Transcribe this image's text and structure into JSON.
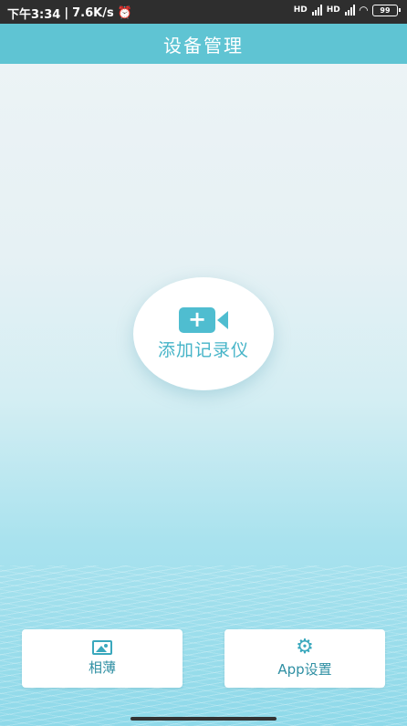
{
  "status_bar": {
    "time": "下午3:34",
    "speed": "7.6K/s",
    "battery": "99",
    "hd1": "HD",
    "hd2": "HD"
  },
  "header": {
    "title": "设备管理"
  },
  "main": {
    "add_label": "添加记录仪",
    "add_icon_symbol": "+"
  },
  "bottom": {
    "album_label": "相薄",
    "settings_label": "App设置"
  },
  "colors": {
    "accent": "#5fc4d3",
    "icon": "#3aa8bd",
    "status_bg": "#2e2e2e"
  }
}
